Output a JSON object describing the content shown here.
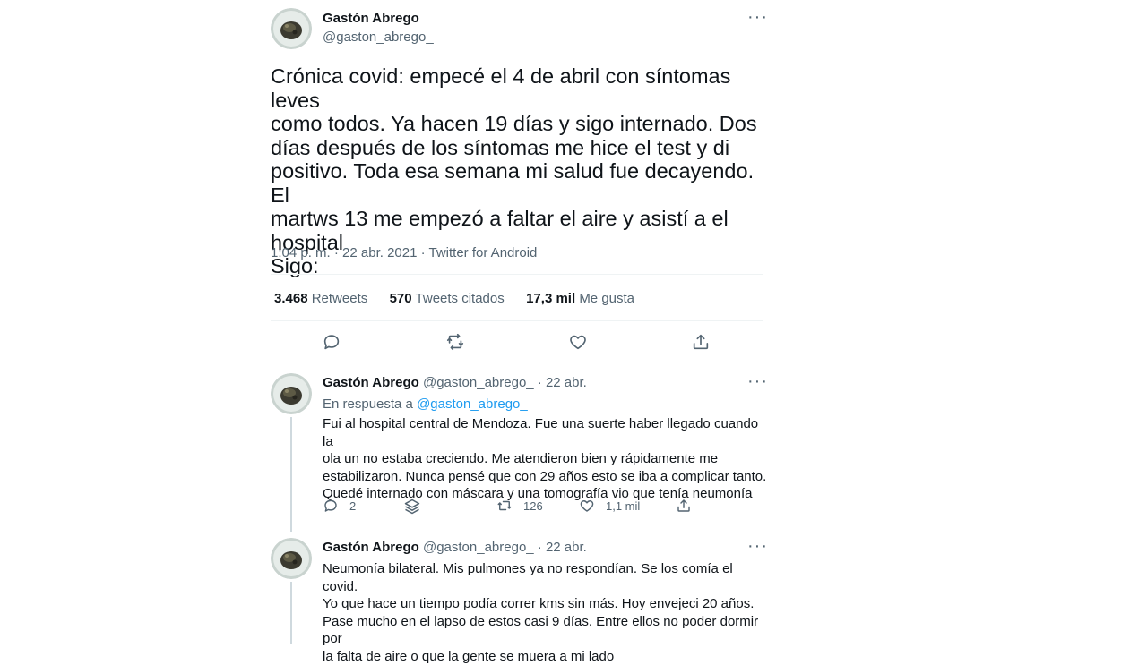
{
  "main_tweet": {
    "author_name": "Gastón Abrego",
    "handle": "@gaston_abrego_",
    "text": "Crónica covid: empecé el 4 de abril con síntomas leves\ncomo todos. Ya hacen 19 días y sigo internado. Dos\ndías después de los síntomas me hice el test y di\npositivo. Toda esa semana mi salud fue decayendo. El\nmartws 13 me empezó a faltar el aire y asistí a el\nhospital\nSigo:",
    "meta": "1:04 p. m. · 22 abr. 2021 · Twitter for Android",
    "stats": {
      "retweets_count": "3.468",
      "retweets_label": "Retweets",
      "quotes_count": "570",
      "quotes_label": "Tweets citados",
      "likes_count": "17,3 mil",
      "likes_label": "Me gusta"
    },
    "more_label": "···"
  },
  "replies": [
    {
      "author_name": "Gastón Abrego",
      "handle_date": "@gaston_abrego_ · 22 abr.",
      "reply_prefix": "En respuesta a ",
      "reply_to": "@gaston_abrego_",
      "text": "Fui al hospital central de Mendoza. Fue una suerte haber llegado cuando la\nola un no estaba creciendo. Me atendieron bien y rápidamente me\nestabilizaron. Nunca pensé que con 29 años esto se iba a complicar tanto.\nQuedé internado con máscara y una tomografía vio que tenía neumonía",
      "reply_count": "2",
      "retweet_count": "126",
      "like_count": "1,1 mil",
      "more_label": "···"
    },
    {
      "author_name": "Gastón Abrego",
      "handle_date": "@gaston_abrego_ · 22 abr.",
      "text": "Neumonía bilateral. Mis pulmones ya no respondían. Se los comía el covid.\nYo que hace un tiempo podía correr kms sin más. Hoy envejeci 20 años.\nPase mucho en el lapso de estos casi 9 días. Entre ellos no poder dormir por\nla falta de aire o que la gente se muera a mi lado",
      "more_label": "···"
    }
  ],
  "icons": {
    "reply": "reply-icon",
    "retweet": "retweet-icon",
    "like": "heart-icon",
    "share": "share-icon",
    "layers": "layers-icon"
  },
  "colors": {
    "link": "#1d9bf0",
    "secondary": "#536471",
    "divider": "#eff3f4"
  }
}
